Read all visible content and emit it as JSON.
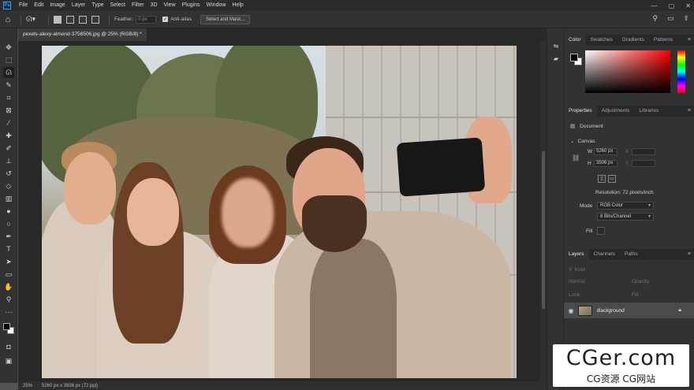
{
  "menu": [
    "File",
    "Edit",
    "Image",
    "Layer",
    "Type",
    "Select",
    "Filter",
    "3D",
    "View",
    "Plugins",
    "Window",
    "Help"
  ],
  "app_logo": "Ps",
  "window_controls": [
    "—",
    "▢",
    "✕"
  ],
  "options": {
    "feather_label": "Feather:",
    "feather_value": "0 px",
    "anti_alias_label": "Anti-alias",
    "select_mask_label": "Select and Mask..."
  },
  "document": {
    "tab_title": "pexels-alexy-almond-3756506.jpg @ 25% (RGB/8) *",
    "zoom": "25%",
    "status_info": "5260 px x 3506 px (72 ppi)"
  },
  "color_panel": {
    "tabs": [
      "Color",
      "Swatches",
      "Gradients",
      "Patterns"
    ],
    "active_tab": "Color"
  },
  "properties_panel": {
    "tabs": [
      "Properties",
      "Adjustments",
      "Libraries"
    ],
    "active_tab": "Properties",
    "document_label": "Document",
    "canvas_label": "Canvas",
    "width_label": "W",
    "width_value": "5260 px",
    "height_label": "H",
    "height_value": "3506 px",
    "x_label": "X",
    "y_label": "Y",
    "resolution": "Resolution: 72 pixels/inch",
    "mode_label": "Mode",
    "mode_value": "RGB Color",
    "depth_value": "8 Bits/Channel",
    "fill_label": "Fill"
  },
  "layers_panel": {
    "tabs": [
      "Layers",
      "Channels",
      "Paths"
    ],
    "active_tab": "Layers",
    "search_placeholder": "Kind",
    "blend_mode": "Normal",
    "opacity_label": "Opacity:",
    "lock_label": "Lock:",
    "fill_label": "Fill:",
    "layer_name": "Background"
  },
  "watermark": {
    "main": "CGer.com",
    "sub": "CG资源 CG网站"
  }
}
